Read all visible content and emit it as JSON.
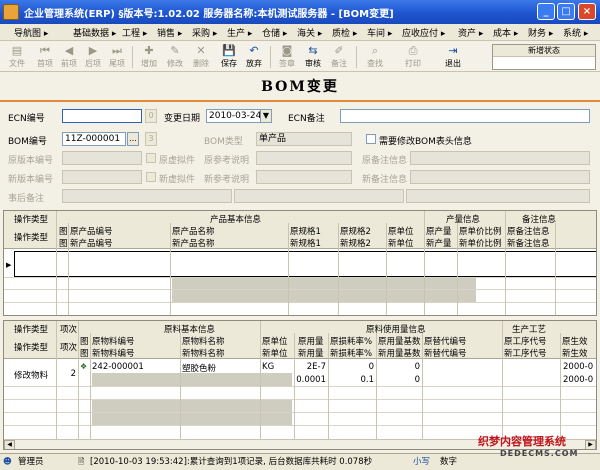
{
  "window": {
    "title": "企业管理系统(ERP)  §版本号:1.02.02   服务器名称:本机测试服务器 - [BOM变更]",
    "min": "_",
    "max": "□",
    "close": "×"
  },
  "menu": [
    "导航图 ▸",
    "基础数据 ▸",
    "工程 ▸",
    "销售 ▸",
    "采购 ▸",
    "生产 ▸",
    "仓储 ▸",
    "海关 ▸",
    "质检 ▸",
    "车间 ▸",
    "应收应付 ▸",
    "资产 ▸",
    "成本 ▸",
    "财务 ▸",
    "系统 ▸"
  ],
  "toolbar": {
    "file": "文件",
    "first": "首项",
    "prev": "前项",
    "next": "后项",
    "last": "尾项",
    "add": "增加",
    "edit": "修改",
    "delete": "删除",
    "save": "保存",
    "discard": "放弃",
    "copy": "签章",
    "audit": "审核",
    "memo": "备注",
    "find": "查找",
    "print": "打印",
    "exit": "退出",
    "status_title": "新增状态"
  },
  "page_title": "BOM变更",
  "header": {
    "ecn_no_label": "ECN编号",
    "ecn_no": "",
    "ecn_no_btn": "0",
    "change_date_label": "变更日期",
    "change_date": "2010-03-24",
    "ecn_note_label": "ECN备注",
    "ecn_note": "",
    "bom_no_label": "BOM编号",
    "bom_no": "11Z-000001",
    "bom_btn": "...",
    "bom_btn2": "3",
    "bom_type_label": "BOM类型",
    "bom_type": "单产品",
    "need_modify_label": "需要修改BOM表头信息",
    "orig_ver_label": "原版本编号",
    "orig_virtual_label": "原虚拟件",
    "orig_ref_label": "原参考说明",
    "orig_note_label": "原备注信息",
    "new_ver_label": "新版本编号",
    "new_virtual_label": "新虚拟件",
    "new_ref_label": "新参考说明",
    "new_note_label": "新备注信息",
    "post_note_label": "事后备注"
  },
  "grid1": {
    "col_op": "操作类型",
    "group_basic": "产品基本信息",
    "group_qty": "产量信息",
    "group_note": "备注信息",
    "row1": [
      "图",
      "原产品编号",
      "原产品名称",
      "原规格1",
      "原规格2",
      "原单位",
      "原产量",
      "原单价比例",
      "原备注信息"
    ],
    "row2": [
      "图",
      "新产品编号",
      "新产品名称",
      "新规格1",
      "新规格2",
      "新单位",
      "新产量",
      "新单价比例",
      "新备注信息"
    ],
    "op_label": "操作类型"
  },
  "grid2": {
    "col_op": "操作类型",
    "col_seq": "项次",
    "group_basic": "原料基本信息",
    "group_usage": "原料使用量信息",
    "group_proc": "生产工艺",
    "row1": [
      "图",
      "原物料编号",
      "原物料名称",
      "原单位",
      "原用量",
      "原损耗率%",
      "原用量基数",
      "原替代编号",
      "原工序代号",
      "原生效"
    ],
    "row2": [
      "图",
      "新物料编号",
      "新物料名称",
      "新单位",
      "新用量",
      "新损耗率%",
      "新用量基数",
      "新替代编号",
      "新工序代号",
      "新生效"
    ],
    "data_row": {
      "op": "修改物料",
      "seq": "2",
      "orig": {
        "code": "242-000001",
        "name": "塑胶色粉",
        "unit": "KG",
        "qty": "2E-7",
        "loss": "0",
        "base": "0",
        "date": "2000-0"
      },
      "new": {
        "qty": "0.0001",
        "loss": "0.1",
        "base": "0",
        "date": "2000-0"
      }
    }
  },
  "statusbar": {
    "user": "管理员",
    "message": "[2010-10-03 19:53:42]:累计查询到1项记录, 后台数据库共耗时 0.078秒",
    "mode": "小写",
    "num": "数字"
  },
  "watermark": {
    "line1": "织梦内容管理系统",
    "line2": "DEDECMS.COM"
  }
}
